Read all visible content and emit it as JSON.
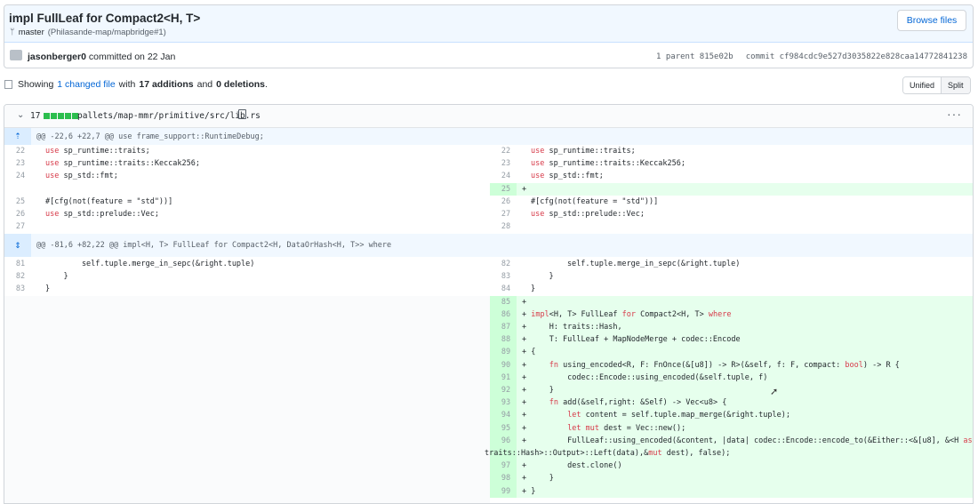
{
  "commit": {
    "title": "impl FullLeaf for Compact2<H, T>",
    "branch": "master",
    "pr_ref": "(Philasande-map/mapbridge#1)",
    "browse_label": "Browse files",
    "committer": "jasonberger0",
    "committed_text": "committed on 22 Jan",
    "parent_label": "1 parent",
    "parent_hash": "815e02b",
    "commit_label": "commit",
    "commit_hash": "cf984cdc9e527d3035822e828caa14772841238"
  },
  "summary": {
    "showing": "Showing",
    "changed_files": "1 changed file",
    "with": "with",
    "additions": "17 additions",
    "and": "and",
    "deletions": "0 deletions",
    "period": "."
  },
  "view_toggle": {
    "unified": "Unified",
    "split": "Split"
  },
  "file": {
    "count": "17",
    "path": "pallets/map-mmr/primitive/src/lib.rs",
    "more": "···"
  },
  "hunks": [
    {
      "header": "@@ -22,6 +22,7 @@ use frame_support::RuntimeDebug;"
    },
    {
      "header": "@@ -81,6 +82,22 @@ impl<H, T> FullLeaf for Compact2<H, DataOrHash<H, T>> where"
    }
  ],
  "left_lines": [
    {
      "n": "22",
      "code": "use sp_runtime::traits;"
    },
    {
      "n": "23",
      "code": "use sp_runtime::traits::Keccak256;"
    },
    {
      "n": "24",
      "code": "use sp_std::fmt;"
    },
    {
      "n": "25",
      "code": "#[cfg(not(feature = \"std\"))]"
    },
    {
      "n": "26",
      "code": "use sp_std::prelude::Vec;"
    },
    {
      "n": "27",
      "code": ""
    },
    {
      "n": "81",
      "code": "        self.tuple.merge_in_sepc(&right.tuple)"
    },
    {
      "n": "82",
      "code": "    }"
    },
    {
      "n": "83",
      "code": "}"
    }
  ],
  "right_lines": [
    {
      "n": "22",
      "code": "use sp_runtime::traits;"
    },
    {
      "n": "23",
      "code": "use sp_runtime::traits::Keccak256;"
    },
    {
      "n": "24",
      "code": "use sp_std::fmt;"
    },
    {
      "n": "25",
      "code": "+"
    },
    {
      "n": "26",
      "code": "#[cfg(not(feature = \"std\"))]"
    },
    {
      "n": "27",
      "code": "use sp_std::prelude::Vec;"
    },
    {
      "n": "28",
      "code": ""
    },
    {
      "n": "82",
      "code": "        self.tuple.merge_in_sepc(&right.tuple)"
    },
    {
      "n": "83",
      "code": "    }"
    },
    {
      "n": "84",
      "code": "}"
    },
    {
      "n": "85",
      "code": "+"
    },
    {
      "n": "86",
      "code": "+ impl<H, T> FullLeaf for Compact2<H, T> where"
    },
    {
      "n": "87",
      "code": "+     H: traits::Hash,"
    },
    {
      "n": "88",
      "code": "+     T: FullLeaf + MapNodeMerge + codec::Encode"
    },
    {
      "n": "89",
      "code": "+ {"
    },
    {
      "n": "90",
      "code": "+     fn using_encoded<R, F: FnOnce(&[u8]) -> R>(&self, f: F, compact: bool) -> R {"
    },
    {
      "n": "91",
      "code": "+         codec::Encode::using_encoded(&self.tuple, f)"
    },
    {
      "n": "92",
      "code": "+     }"
    },
    {
      "n": "93",
      "code": "+     fn add(&self,right: &Self) -> Vec<u8> {"
    },
    {
      "n": "94",
      "code": "+         let content = self.tuple.map_merge(&right.tuple);"
    },
    {
      "n": "95",
      "code": "+         let mut dest = Vec::new();"
    },
    {
      "n": "96",
      "code": "+         FullLeaf::using_encoded(&content, |data| codec::Encode::encode_to(&Either::<&[u8], &<H as"
    },
    {
      "n": "",
      "code": "traits::Hash>::Output>::Left(data),&mut dest), false);"
    },
    {
      "n": "97",
      "code": "+         dest.clone()"
    },
    {
      "n": "98",
      "code": "+     }"
    },
    {
      "n": "99",
      "code": "+ }"
    }
  ],
  "colors": {
    "accent": "#0366d6",
    "add_bg": "#e6ffed",
    "add_num_bg": "#cdffd8",
    "hunk_bg": "#f1f8ff",
    "bar_green": "#2cbe4e"
  },
  "icons": {
    "branch": "git-branch-icon",
    "file": "file-diff-icon",
    "copy": "copy-icon",
    "chevron": "chevron-down-icon",
    "expand": "expand-icon"
  }
}
